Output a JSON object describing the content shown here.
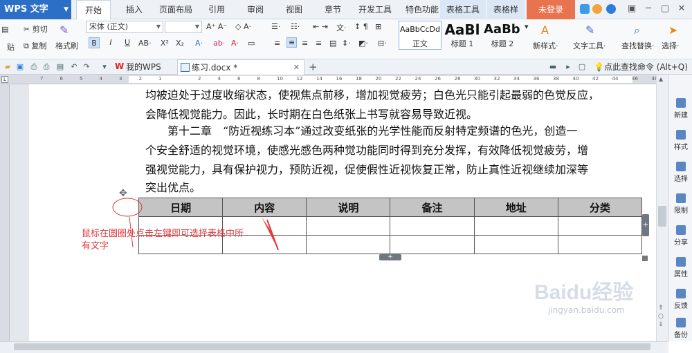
{
  "app": {
    "name": "WPS 文字",
    "login": "未登录"
  },
  "menu_tabs": [
    "开始",
    "插入",
    "页面布局",
    "引用",
    "审阅",
    "视图",
    "章节",
    "开发工具",
    "特色功能",
    "表格工具",
    "表格样"
  ],
  "ribbon": {
    "cut": "剪切",
    "copy": "复制",
    "format_painter": "格式刷",
    "paste_partial": "贴",
    "font_name": "宋体 (正文)",
    "font_size": "",
    "bold": "B",
    "italic": "I",
    "underline": "U",
    "styles": [
      {
        "sample": "AaBbCcDd",
        "label": "正文"
      },
      {
        "sample": "AaBl",
        "label": "标题 1"
      },
      {
        "sample": "AaBb(",
        "label": "标题 2"
      }
    ],
    "new_style": "新样式",
    "text_tools": "文字工具",
    "find_replace": "查找替换",
    "select": "选择"
  },
  "doc_tabs": {
    "home": "我的WPS",
    "current": "练习.docx *",
    "search_cmd": "点此查找命令 (Alt+Q)"
  },
  "ruler_numbers": [
    "7",
    "6",
    "5",
    "4",
    "3",
    "2",
    "1",
    "",
    "2",
    "4",
    "6",
    "8",
    "10",
    "12",
    "14",
    "16",
    "18",
    "20",
    "22",
    "24",
    "26",
    "28",
    "30",
    "32",
    "34",
    "36",
    "38",
    "40",
    "42",
    "44",
    "46",
    "48"
  ],
  "body_lines": [
    "均被迫处于过度收缩状态，使视焦点前移，增加视觉疲劳；白色光只能引起最弱的色觉反应，",
    "会降低视觉能力。因此，长时期在白色纸张上书写就容易导致近视。",
    "　　第十二章　“防近视练习本”通过改变纸张的光学性能而反射特定频谱的色光，创造一",
    "个安全舒适的视觉环境，使感光感色两种觉功能同时得到充分发挥，有效降低视觉疲劳，增",
    "强视觉能力，具有保护视力，预防近视，促使假性近视恢复正常，防止真性近视继续加深等",
    "突出优点。"
  ],
  "table": {
    "headers": [
      "日期",
      "内容",
      "说明",
      "备注",
      "地址",
      "分类"
    ],
    "rows": [
      [
        "",
        "",
        "",
        "",
        "",
        ""
      ],
      [
        "",
        "",
        "",
        "",
        "",
        ""
      ]
    ]
  },
  "annotation": "鼠标在圆圈处点击左键即可选择表格中所有文字",
  "side_panel": [
    "新建",
    "样式",
    "选择",
    "限制",
    "分享",
    "属性",
    "反馈",
    "备份"
  ],
  "watermark": {
    "brand": "Baidu经验",
    "url": "jingyan.baidu.com"
  }
}
